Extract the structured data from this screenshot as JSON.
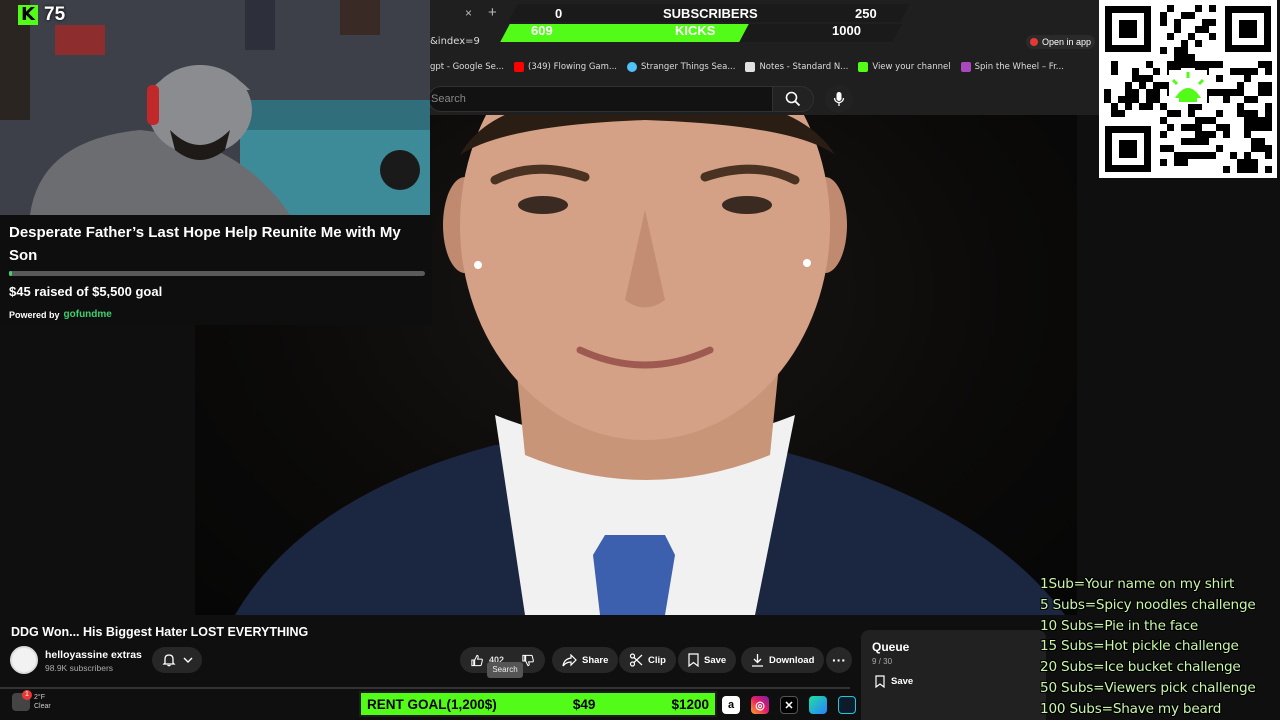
{
  "browser": {
    "tab_close": "×",
    "tab_new": "+",
    "url_fragment": "&index=9",
    "open_in_app": "Open in app",
    "bookmarks": [
      {
        "label": "gpt - Google Se...",
        "color": "#4285f4"
      },
      {
        "label": "(349) Flowing Gam...",
        "color": "#ff0000"
      },
      {
        "label": "Stranger Things Sea...",
        "color": "#4fc3f7"
      },
      {
        "label": "Notes - Standard N...",
        "color": "#e0e0e0"
      },
      {
        "label": "View your channel",
        "color": "#53fc18"
      },
      {
        "label": "Spin the Wheel – Fr...",
        "color": "#ab47bc"
      }
    ]
  },
  "youtube": {
    "search_placeholder": "Search",
    "video_title": "DDG Won... His Biggest Hater LOST EVERYTHING",
    "channel_name": "helloyassine extras",
    "channel_subs": "98.9K subscribers",
    "like_count": "402",
    "tooltip": "Search",
    "share_label": "Share",
    "clip_label": "Clip",
    "save_label": "Save",
    "download_label": "Download",
    "queue_title": "Queue",
    "queue_count": "9 / 30",
    "queue_save": "Save"
  },
  "counter": {
    "subs_current": "0",
    "subs_label": "SUBSCRIBERS",
    "subs_goal": "250",
    "kicks_current": "609",
    "kicks_label": "KICKS",
    "kicks_goal": "1000",
    "kicks_progress": 0.609
  },
  "kick_badge": {
    "letter": "K",
    "count": "75"
  },
  "gofundme": {
    "title": "Desperate Father’s Last Hope Help Reunite Me with My Son",
    "raised": "$45 raised of $5,500 goal",
    "progress": 0.008,
    "powered_by": "Powered by",
    "logo": "gofundme"
  },
  "taskbar": {
    "weather_temp": "2°F",
    "weather_desc": "Clear",
    "weather_badge": "1",
    "rent_label": "RENT GOAL(1,200$)",
    "rent_current": "$49",
    "rent_goal": "$1200",
    "tray_icons": [
      "amazon-icon",
      "instagram-icon",
      "x-icon",
      "copilot-icon",
      "app-icon"
    ]
  },
  "sub_goals": [
    "1Sub=Your name on my shirt",
    "5 Subs=Spicy noodles challenge",
    "10 Subs=Pie in the face",
    "15 Subs=Hot pickle challenge",
    "20 Subs=Ice bucket challenge",
    "50 Subs=Viewers pick challenge",
    "100 Subs=Shave my beard"
  ],
  "colors": {
    "kick_green": "#53fc18",
    "gofundme_green": "#3bd16f",
    "yt_dark": "#0f0f0f"
  }
}
